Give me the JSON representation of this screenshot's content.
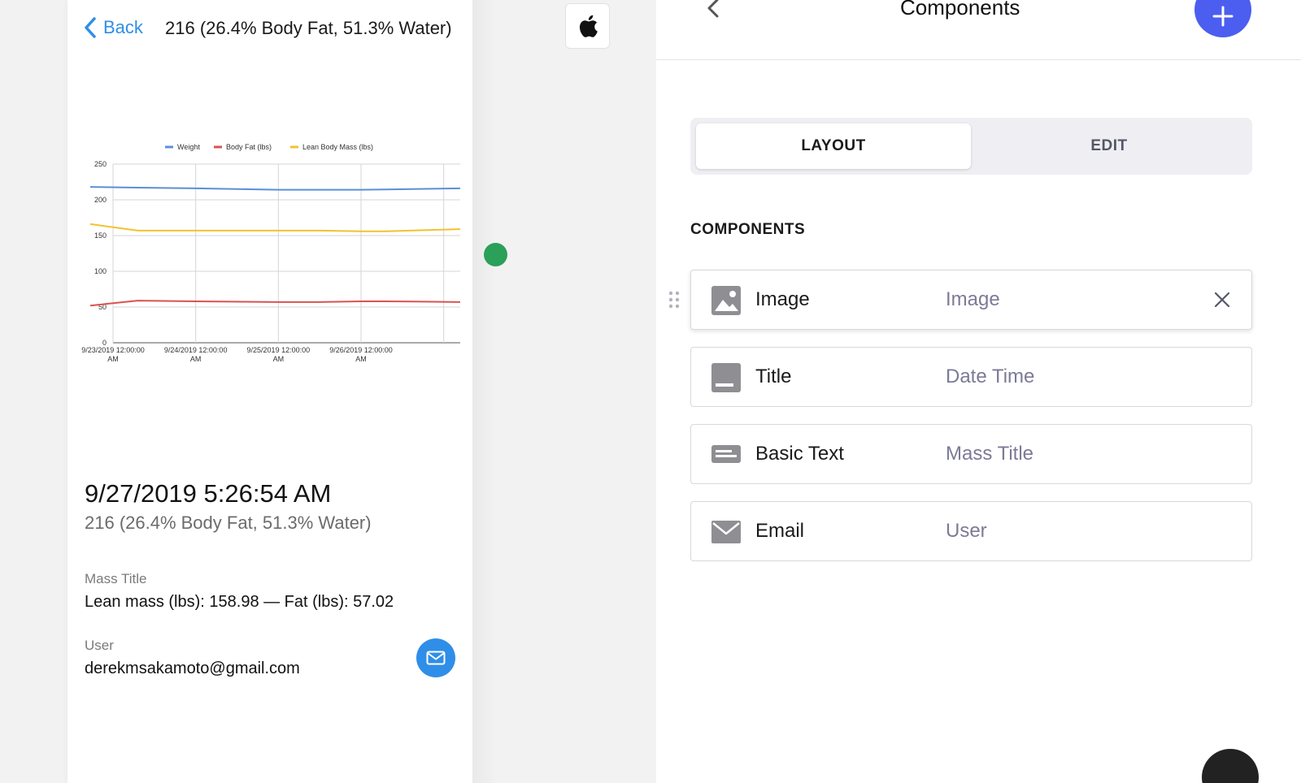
{
  "phone": {
    "back_label": "Back",
    "header_title": "216 (26.4% Body Fat, 51.3% Water)",
    "record_date": "9/27/2019 5:26:54 AM",
    "record_sub": "216 (26.4% Body Fat, 51.3% Water)",
    "mass_label": "Mass Title",
    "mass_value": "Lean mass (lbs): 158.98 — Fat (lbs): 57.02",
    "user_label": "User",
    "user_value": "derekmsakamoto@gmail.com"
  },
  "panel": {
    "title": "Components",
    "tabs": {
      "layout": "LAYOUT",
      "edit": "EDIT"
    },
    "section_label": "COMPONENTS",
    "components": [
      {
        "name": "Image",
        "value": "Image",
        "icon": "image-icon"
      },
      {
        "name": "Title",
        "value": "Date Time",
        "icon": "title-icon"
      },
      {
        "name": "Basic Text",
        "value": "Mass Title",
        "icon": "basic-text-icon"
      },
      {
        "name": "Email",
        "value": "User",
        "icon": "email-icon"
      }
    ]
  },
  "colors": {
    "accent_blue": "#2f8ee8",
    "fab_blue": "#4c5ef0",
    "status_green": "#2aa058",
    "weight": "#5b8fd6",
    "body_fat": "#d9534f",
    "lean_mass": "#f2c230"
  },
  "chart_data": {
    "type": "line",
    "legend": [
      "Weight",
      "Body Fat (lbs)",
      "Lean Body Mass (lbs)"
    ],
    "legend_position": "top",
    "x_ticks": [
      [
        "9/23/2019 12:00:00",
        "AM"
      ],
      [
        "9/24/2019 12:00:00",
        "AM"
      ],
      [
        "9/25/2019 12:00:00",
        "AM"
      ],
      [
        "9/26/2019 12:00:00",
        "AM"
      ]
    ],
    "y_ticks": [
      "0",
      "50",
      "100",
      "150",
      "200",
      "250"
    ],
    "ylim": [
      0,
      250
    ],
    "x": [
      0,
      0.3,
      1,
      2,
      2.5,
      3,
      3.3,
      4.2
    ],
    "series": [
      {
        "name": "Weight",
        "values": [
          218,
          217,
          216,
          214,
          214,
          214,
          214.5,
          216
        ]
      },
      {
        "name": "Body Fat (lbs)",
        "values": [
          52,
          59,
          58,
          57,
          57,
          58,
          58,
          57
        ]
      },
      {
        "name": "Lean Body Mass (lbs)",
        "values": [
          166,
          157,
          157,
          157,
          157,
          156,
          156,
          159
        ]
      }
    ],
    "grid": true
  }
}
